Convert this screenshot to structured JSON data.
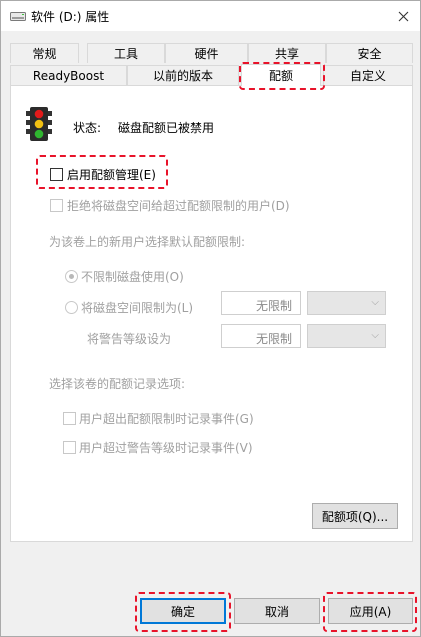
{
  "window": {
    "title": "软件 (D:) 属性",
    "close_label": "✕"
  },
  "tabs": {
    "row1": [
      "常规",
      "工具",
      "硬件",
      "共享",
      "安全"
    ],
    "row2": [
      "ReadyBoost",
      "以前的版本",
      "配额",
      "自定义"
    ],
    "active": "配额"
  },
  "status": {
    "label": "状态:",
    "value": "磁盘配额已被禁用"
  },
  "options": {
    "enable_quota": "启用配额管理(E)",
    "deny_space": "拒绝将磁盘空间给超过配额限制的用户(D)",
    "default_limit_heading": "为该卷上的新用户选择默认配额限制:",
    "no_limit": "不限制磁盘使用(O)",
    "limit_space": "将磁盘空间限制为(L)",
    "limit_value": "无限制",
    "warning_label": "将警告等级设为",
    "warning_value": "无限制",
    "log_heading": "选择该卷的配额记录选项:",
    "log_exceed_limit": "用户超出配额限制时记录事件(G)",
    "log_exceed_warning": "用户超过警告等级时记录事件(V)"
  },
  "buttons": {
    "quota_entries": "配额项(Q)...",
    "ok": "确定",
    "cancel": "取消",
    "apply": "应用(A)"
  },
  "colors": {
    "highlight": "#e8132a",
    "focus_border": "#0078d7"
  }
}
